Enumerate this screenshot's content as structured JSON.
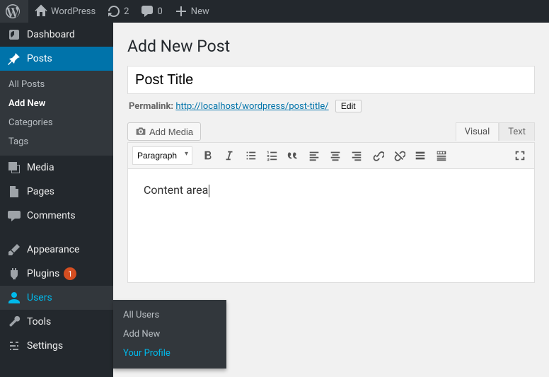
{
  "adminbar": {
    "site_name": "WordPress",
    "updates_count": "2",
    "comments_count": "0",
    "new_label": "New"
  },
  "sidebar": {
    "dashboard": "Dashboard",
    "posts": "Posts",
    "posts_sub": {
      "all": "All Posts",
      "add": "Add New",
      "cats": "Categories",
      "tags": "Tags"
    },
    "media": "Media",
    "pages": "Pages",
    "comments": "Comments",
    "appearance": "Appearance",
    "plugins": "Plugins",
    "plugins_badge": "1",
    "users": "Users",
    "tools": "Tools",
    "settings": "Settings"
  },
  "flyout": {
    "all_users": "All Users",
    "add_new": "Add New",
    "profile": "Your Profile"
  },
  "content": {
    "heading": "Add New Post",
    "title_value": "Post Title",
    "permalink_label": "Permalink:",
    "permalink_base": "http://localhost/wordpress/",
    "permalink_slug": "post-title/",
    "edit_btn": "Edit",
    "add_media": "Add Media",
    "tab_visual": "Visual",
    "tab_text": "Text",
    "format_option": "Paragraph",
    "body_text": "Content area"
  }
}
